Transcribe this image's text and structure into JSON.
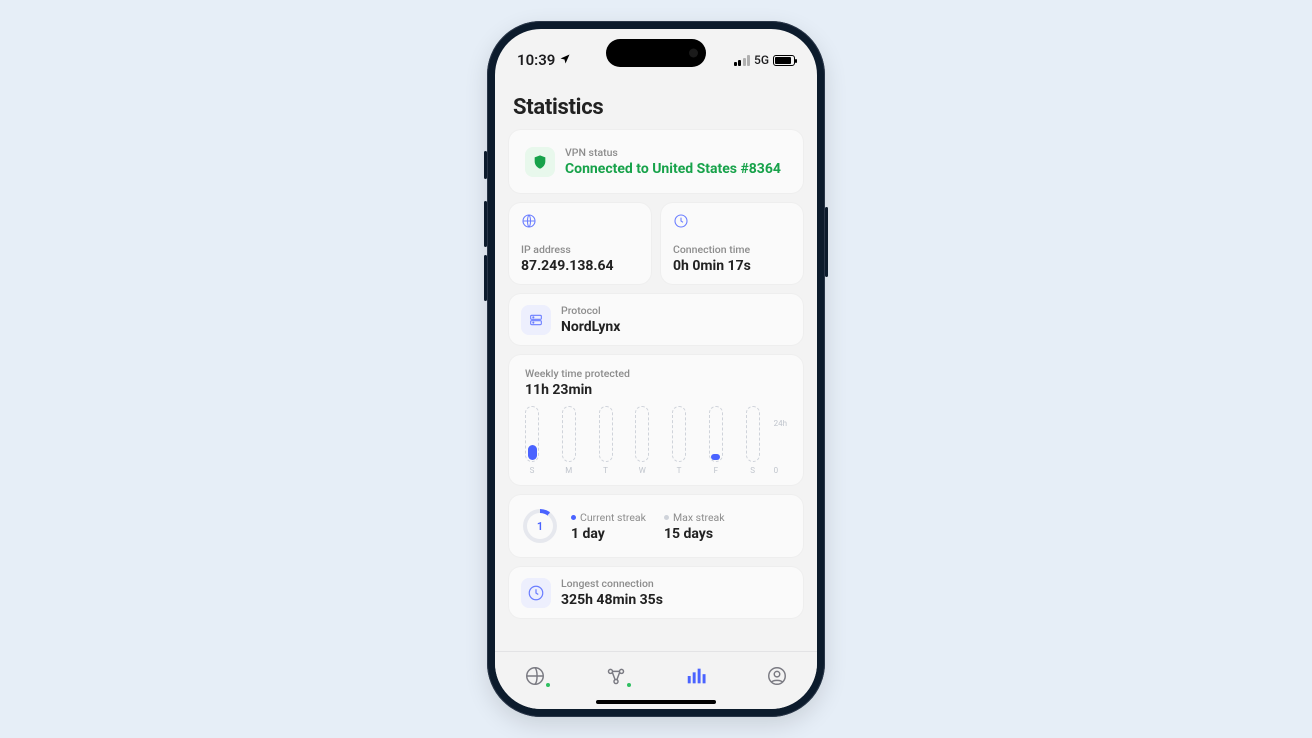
{
  "statusbar": {
    "time": "10:39",
    "network": "5G"
  },
  "page_title": "Statistics",
  "vpn": {
    "label": "VPN status",
    "status_text": "Connected to United States #8364"
  },
  "ip": {
    "label": "IP address",
    "value": "87.249.138.64"
  },
  "conn_time": {
    "label": "Connection time",
    "value": "0h 0min 17s"
  },
  "protocol": {
    "label": "Protocol",
    "value": "NordLynx"
  },
  "weekly": {
    "label": "Weekly time protected",
    "value": "11h 23min"
  },
  "streak": {
    "ring_value": "1",
    "current_label": "Current streak",
    "current_value": "1 day",
    "max_label": "Max streak",
    "max_value": "15 days"
  },
  "longest": {
    "label": "Longest connection",
    "value": "325h 48min 35s"
  },
  "chart_data": {
    "type": "bar",
    "title": "Weekly time protected",
    "categories": [
      "S",
      "M",
      "T",
      "W",
      "T",
      "F",
      "S"
    ],
    "values": [
      7,
      0,
      0,
      0,
      0,
      2,
      0
    ],
    "ylabel": "hours",
    "ylim": [
      0,
      24
    ],
    "y_top_label": "24h",
    "y_bot_label": "0"
  }
}
